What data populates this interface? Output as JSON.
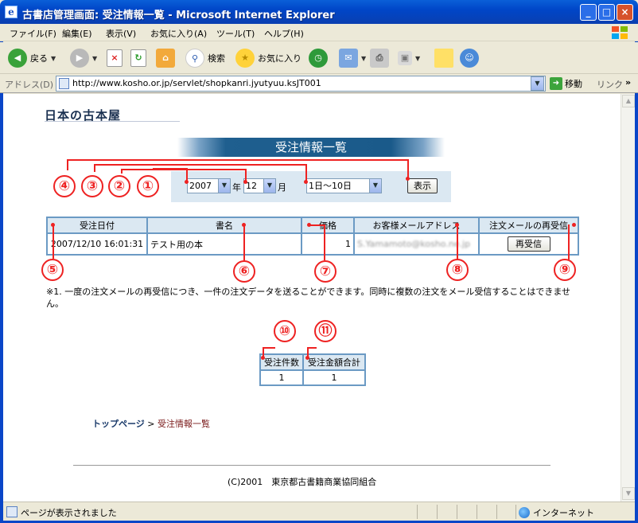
{
  "window": {
    "title": "古書店管理画面: 受注情報一覧 - Microsoft Internet Explorer",
    "min": "_",
    "max": "□",
    "close": "×"
  },
  "menu": [
    "ファイル(F)",
    "編集(E)",
    "表示(V)",
    "お気に入り(A)",
    "ツール(T)",
    "ヘルプ(H)"
  ],
  "toolbar": {
    "back": "戻る",
    "search": "検索",
    "favorites": "お気に入り"
  },
  "address": {
    "label": "アドレス(D)",
    "url": "http://www.kosho.or.jp/servlet/shopkanri.jyutyuu.ksJT001",
    "go": "移動",
    "links": "リンク"
  },
  "page": {
    "logo": "日本の古本屋",
    "heading": "受注情報一覧",
    "form": {
      "year": "2007",
      "year_unit": "年",
      "month": "12",
      "month_unit": "月",
      "period": "1日〜10日",
      "show": "表示"
    },
    "orders_table": {
      "headers": [
        "受注日付",
        "書名",
        "価格",
        "お客様メールアドレス",
        "注文メールの再受信"
      ],
      "rows": [
        {
          "date": "2007/12/10 16:01:31",
          "title": "テスト用の本",
          "price": "1",
          "email": "S.Yamamoto@kosho.ne.jp",
          "button": "再受信"
        }
      ]
    },
    "note": "※1. 一度の注文メールの再受信につき、一件の注文データを送ることができます。同時に複数の注文をメール受信することはできません。",
    "summary": {
      "headers": [
        "受注件数",
        "受注金額合計"
      ],
      "values": [
        "1",
        "1"
      ]
    },
    "breadcrumb": {
      "home": "トップページ",
      "sep": ">",
      "current": "受注情報一覧"
    },
    "copyright": "(C)2001　東京都古書籍商業協同組合"
  },
  "annotations": [
    "①",
    "②",
    "③",
    "④",
    "⑤",
    "⑥",
    "⑦",
    "⑧",
    "⑨",
    "⑩",
    "⑪"
  ],
  "status": {
    "text": "ページが表示されました",
    "zone": "インターネット"
  },
  "colors": {
    "accent": "#1a5a8a",
    "table_border": "#6b9ac4",
    "table_header": "#dbe8f2",
    "annotation": "#ee2222"
  }
}
